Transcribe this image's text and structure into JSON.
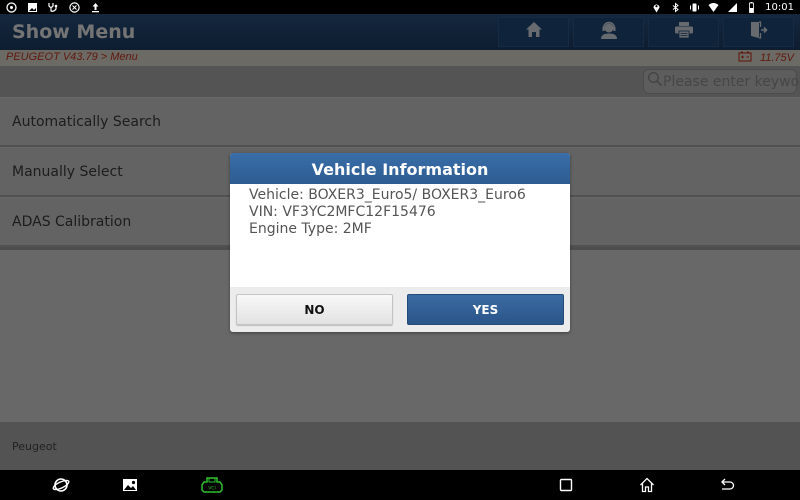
{
  "statusbar": {
    "left_icons": [
      "chat-bubble-icon",
      "image-icon",
      "stethoscope-icon",
      "cd-icon",
      "upload-icon"
    ],
    "right_icons": [
      "location-icon",
      "bluetooth-icon",
      "vibrate-icon",
      "wifi-icon",
      "signal-icon",
      "battery-icon"
    ],
    "time": "10:01"
  },
  "header": {
    "title": "Show Menu",
    "buttons": [
      "home-icon",
      "support-headset-icon",
      "printer-icon",
      "exit-door-icon"
    ]
  },
  "breadcrumb": "PEUGEOT V43.79 > Menu",
  "battery_voltage": "11.75V",
  "search": {
    "placeholder": "Please enter keyword",
    "value": ""
  },
  "menu": {
    "items": [
      {
        "label": "Automatically Search"
      },
      {
        "label": "Manually Select"
      },
      {
        "label": "ADAS Calibration"
      }
    ]
  },
  "footer": {
    "label": "Peugeot"
  },
  "dialog": {
    "title": "Vehicle Information",
    "lines": [
      "Vehicle: BOXER3_Euro5/ BOXER3_Euro6",
      "VIN: VF3YC2MFC12F15476",
      "Engine Type: 2MF"
    ],
    "no_label": "NO",
    "yes_label": "YES"
  },
  "navbar": {
    "left": [
      "browser-planet-icon",
      "gallery-icon",
      "vci-connector-icon"
    ],
    "right": [
      "recents-icon",
      "home-icon",
      "back-icon"
    ],
    "vci_color": "#2ec02e"
  }
}
